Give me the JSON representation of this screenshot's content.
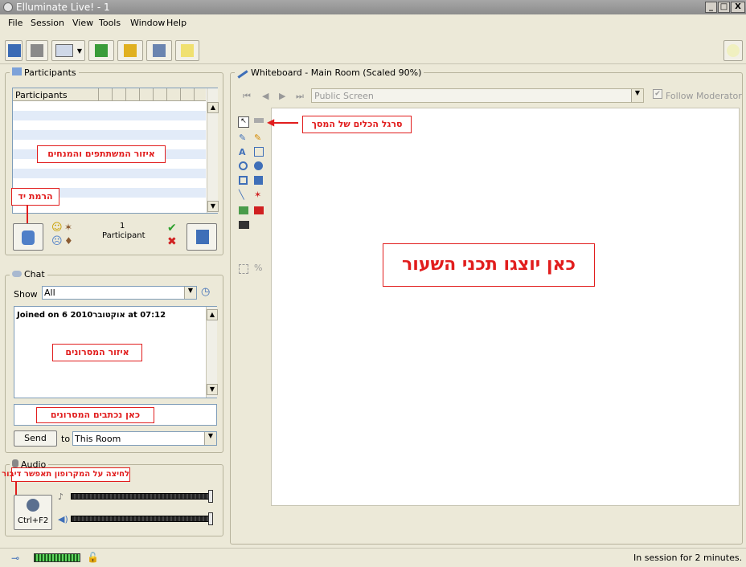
{
  "window": {
    "title": "Elluminate Live! - 1",
    "controls": [
      "_",
      "□",
      "X"
    ]
  },
  "menu": [
    "File",
    "Session",
    "View",
    "Tools",
    "Window",
    "Help"
  ],
  "participants": {
    "panel_title": "Participants",
    "column_header": "Participants",
    "count": "1",
    "count_label": "Participant",
    "annotation_area": "איזור המשתתפים והמנחים",
    "annotation_hand": "הרמת יד"
  },
  "chat": {
    "panel_title": "Chat",
    "show_label": "Show",
    "show_value": "All",
    "message": "Joined on 6 2010אוקטובר  at 07:12",
    "annotation_messages": "איזור המסרונים",
    "annotation_input": "כאן נכתבים המסרונים",
    "send_label": "Send",
    "to_label": "to",
    "to_value": "This Room"
  },
  "audio": {
    "panel_title": "Audio",
    "annotation_mic": "לחיצה על המקרופון תאפשר דיבור",
    "talk_shortcut": "Ctrl+F2",
    "mic_level": 0.95,
    "speaker_level": 0.95
  },
  "whiteboard": {
    "panel_title": "Whiteboard - Main Room (Scaled 90%)",
    "screen_value": "Public Screen",
    "follow_label": "Follow Moderator",
    "annotation_tools": "סרגל הכלים של המסך",
    "annotation_content": "כאן יוצגו תכני השעור"
  },
  "status": {
    "text": "In session for 2 minutes."
  },
  "colors": {
    "annotation": "#e11d1d",
    "stripe": "#e2ebf8",
    "panel": "#ece9d8"
  }
}
